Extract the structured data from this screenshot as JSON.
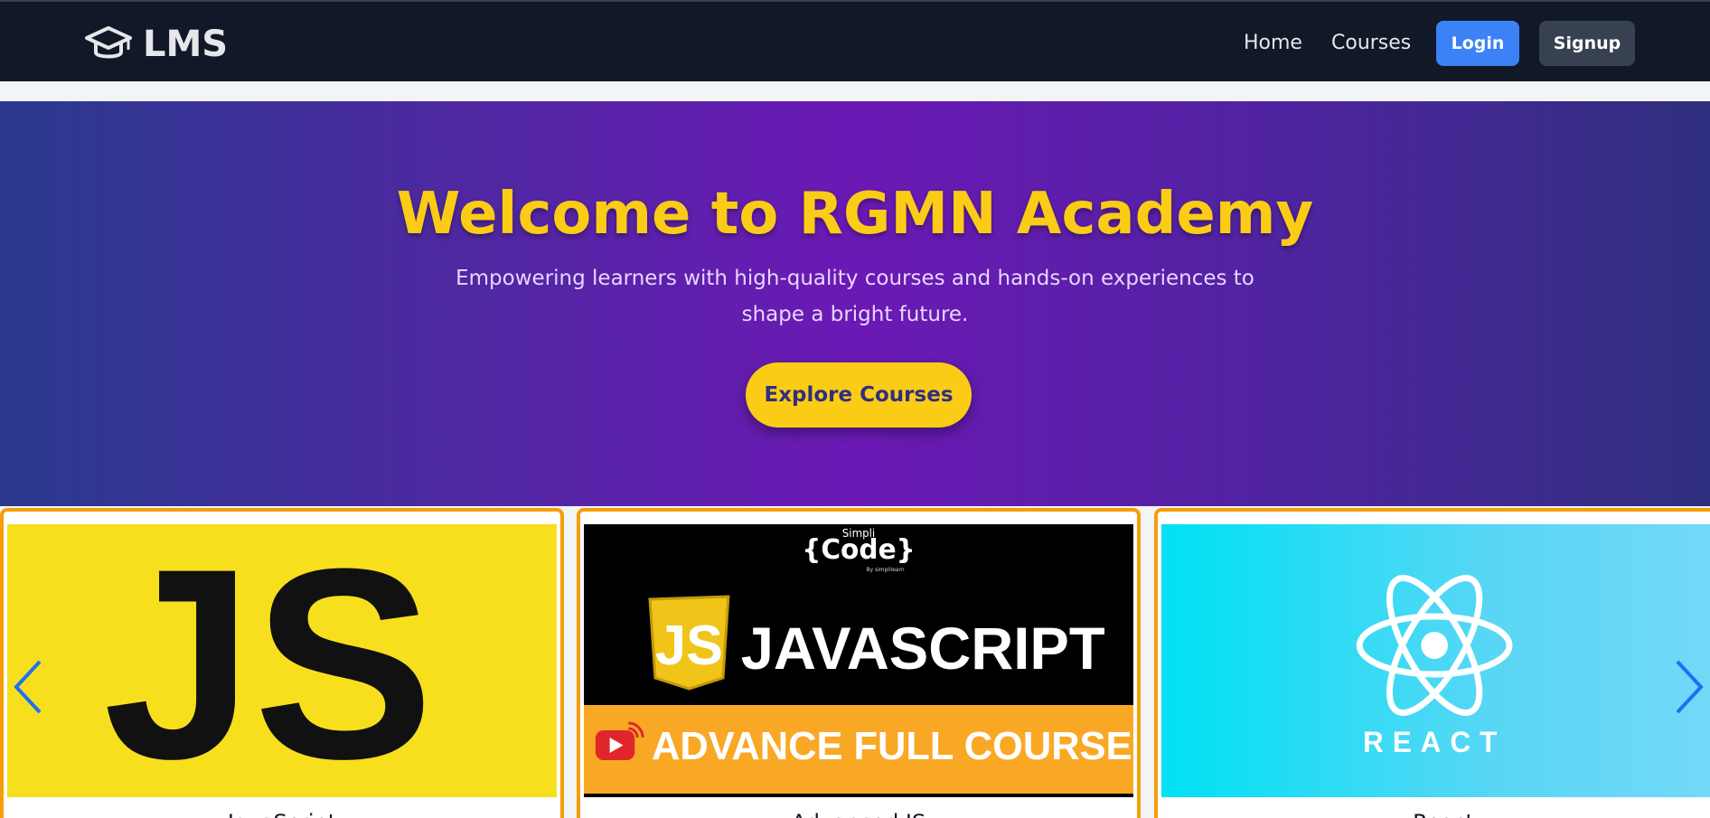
{
  "navbar": {
    "brand": "LMS",
    "links": [
      "Home",
      "Courses"
    ],
    "login_label": "Login",
    "signup_label": "Signup"
  },
  "hero": {
    "title": "Welcome to RGMN Academy",
    "subtitle": "Empowering learners with high-quality courses and hands-on experiences to shape a bright future.",
    "cta_label": "Explore Courses"
  },
  "carousel": {
    "cards": [
      {
        "title": "JavaScript",
        "image": "javascript-logo"
      },
      {
        "title": "Advanced JS",
        "image": "advanced-javascript-banner"
      },
      {
        "title": "React",
        "image": "react-logo"
      }
    ],
    "js_image_text": "JS",
    "adv_banner": {
      "brand_top": "Simpli",
      "brand_main": "{Code}",
      "brand_sub": "By simplilearn",
      "badge": "JS",
      "headline": "JAVASCRIPT",
      "footer": "ADVANCE FULL COURSE"
    },
    "react_text": "REACT"
  },
  "icons": [
    "graduation-cap-icon",
    "chevron-left-icon",
    "chevron-right-icon"
  ],
  "colors": {
    "navbar_bg": "#111827",
    "accent_yellow": "#facc15",
    "login_blue": "#3b82f6",
    "card_border": "#f59e0b"
  }
}
